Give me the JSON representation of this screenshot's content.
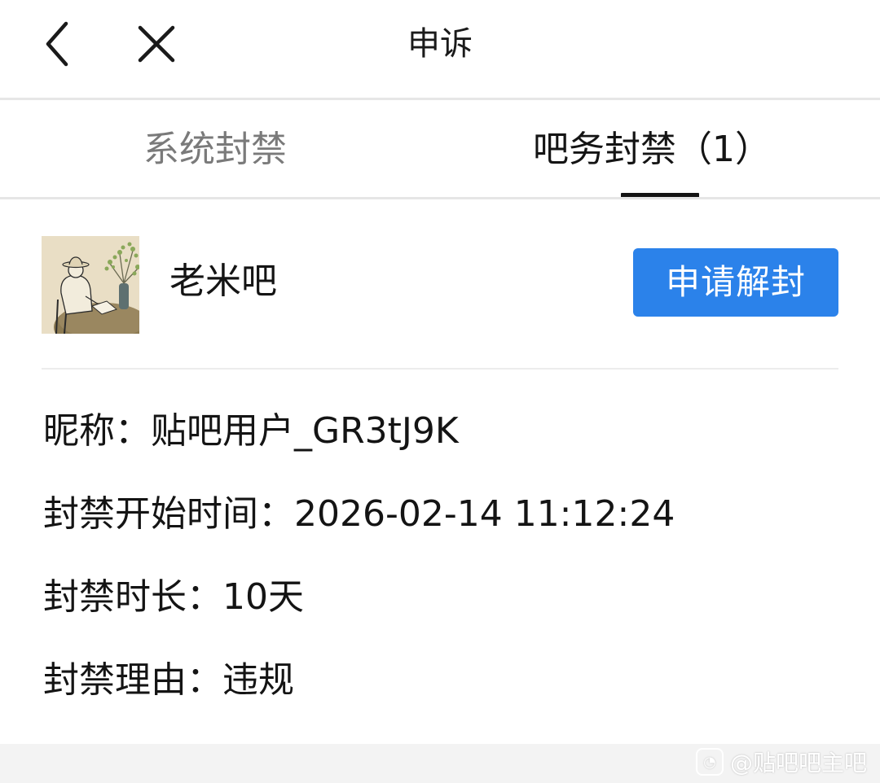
{
  "header": {
    "title": "申诉",
    "back_icon": "chevron-left-icon",
    "close_icon": "close-icon"
  },
  "tabs": [
    {
      "label": "系统封禁",
      "active": false
    },
    {
      "label": "吧务封禁（1）",
      "active": true
    }
  ],
  "forum": {
    "name": "老米吧",
    "appeal_button": "申请解封"
  },
  "details": {
    "nickname_label": "昵称：",
    "nickname": "贴吧用户_GR3tJ9K",
    "start_label": "封禁开始时间：",
    "start": "2026-02-14 11:12:24",
    "duration_label": "封禁时长：",
    "duration": "10天",
    "reason_label": "封禁理由：",
    "reason": "违规"
  },
  "watermark": {
    "text": "@贴吧吧主吧"
  },
  "colors": {
    "accent": "#2b82ea",
    "active_tab": "#141414",
    "inactive_tab": "#7a7a7a",
    "divider": "#e6e6e6"
  }
}
